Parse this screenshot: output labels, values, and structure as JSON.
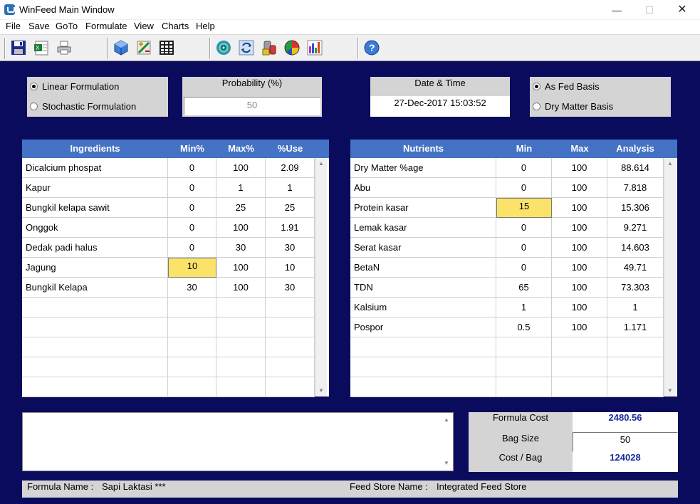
{
  "window": {
    "title": "WinFeed Main Window"
  },
  "menu": [
    "File",
    "Save",
    "GoTo",
    "Formulate",
    "View",
    "Charts",
    "Help"
  ],
  "toolbar_icons": [
    "save-disk-icon",
    "excel-export-icon",
    "print-icon",
    "ingredient-cube-icon",
    "nutrient-tool-icon",
    "calculator-grid-icon",
    "formulate-target-icon",
    "cycle-refresh-icon",
    "feed-mixer-icon",
    "pie-chart-icon",
    "bar-chart-icon",
    "help-icon"
  ],
  "formulation": {
    "linear_label": "Linear Formulation",
    "stochastic_label": "Stochastic Formulation",
    "selected": "linear"
  },
  "probability": {
    "label": "Probability (%)",
    "value": "50"
  },
  "datetime": {
    "label": "Date & Time",
    "value": "27-Dec-2017 15:03:52"
  },
  "basis": {
    "as_fed_label": "As Fed Basis",
    "dry_matter_label": "Dry Matter Basis",
    "selected": "as_fed"
  },
  "ingredients": {
    "headers": [
      "Ingredients",
      "Min%",
      "Max%",
      "%Use"
    ],
    "rows": [
      [
        "Dicalcium phospat",
        "0",
        "100",
        "2.09"
      ],
      [
        "Kapur",
        "0",
        "1",
        "1"
      ],
      [
        "Bungkil kelapa sawit",
        "0",
        "25",
        "25"
      ],
      [
        "Onggok",
        "0",
        "100",
        "1.91"
      ],
      [
        "Dedak padi halus",
        "0",
        "30",
        "30"
      ],
      [
        "Jagung",
        "10",
        "100",
        "10"
      ],
      [
        "Bungkil Kelapa",
        "30",
        "100",
        "30"
      ],
      [
        "",
        "",
        "",
        ""
      ],
      [
        "",
        "",
        "",
        ""
      ],
      [
        "",
        "",
        "",
        ""
      ],
      [
        "",
        "",
        "",
        ""
      ],
      [
        "",
        "",
        "",
        ""
      ]
    ],
    "highlight": {
      "row": 5,
      "col": 1
    }
  },
  "nutrients": {
    "headers": [
      "Nutrients",
      "Min",
      "Max",
      "Analysis"
    ],
    "rows": [
      [
        "Dry Matter %age",
        "0",
        "100",
        "88.614"
      ],
      [
        "Abu",
        "0",
        "100",
        "7.818"
      ],
      [
        "Protein kasar",
        "15",
        "100",
        "15.306"
      ],
      [
        "Lemak kasar",
        "0",
        "100",
        "9.271"
      ],
      [
        "Serat kasar",
        "0",
        "100",
        "14.603"
      ],
      [
        "BetaN",
        "0",
        "100",
        "49.71"
      ],
      [
        "TDN",
        "65",
        "100",
        "73.303"
      ],
      [
        "Kalsium",
        "1",
        "100",
        "1"
      ],
      [
        "Pospor",
        "0.5",
        "100",
        "1.171"
      ],
      [
        "",
        "",
        "",
        ""
      ],
      [
        "",
        "",
        "",
        ""
      ],
      [
        "",
        "",
        "",
        ""
      ]
    ],
    "highlight": {
      "row": 2,
      "col": 1
    }
  },
  "notes": {
    "value": ""
  },
  "cost": {
    "formula_cost_label": "Formula Cost",
    "formula_cost_value": "2480.56",
    "bag_size_label": "Bag  Size",
    "bag_size_value": "50",
    "cost_per_bag_label": "Cost / Bag",
    "cost_per_bag_value": "124028"
  },
  "status": {
    "formula_name_label": "Formula Name :",
    "formula_name_value": "Sapi Laktasi ***",
    "feed_store_label": "Feed Store Name :",
    "feed_store_value": "Integrated Feed Store"
  },
  "colors": {
    "background_navy": "#0b0b5e",
    "grid_header_blue": "#4472c4",
    "highlight_yellow": "#fbe36a",
    "cost_value_blue": "#1a2a9a"
  }
}
